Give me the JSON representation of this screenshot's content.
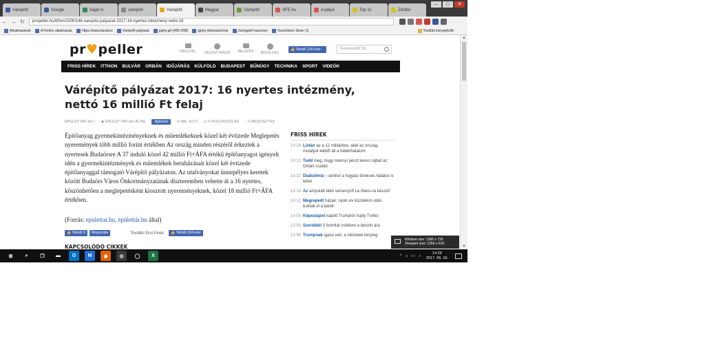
{
  "tabs": [
    {
      "label": "Várépítő",
      "color": "#3b5998"
    },
    {
      "label": "Google",
      "color": "#3b5998"
    },
    {
      "label": "Saját m",
      "color": "#2e8b57"
    },
    {
      "label": "várépítő",
      "color": "#888888"
    },
    {
      "label": "Várépítő",
      "color": "#f2a313",
      "active": true
    },
    {
      "label": "Magyar",
      "color": "#444444"
    },
    {
      "label": "Várépítő",
      "color": "#6a9a3a"
    },
    {
      "label": "SFE.hu",
      "color": "#d9534f"
    },
    {
      "label": "A pályá",
      "color": "#d9534f"
    },
    {
      "label": "Top 11",
      "color": "#d4c21a"
    },
    {
      "label": "Zöldbo",
      "color": "#d4c21a"
    }
  ],
  "window_controls": {
    "minimize": "–",
    "maximize": "□",
    "close": "✕"
  },
  "address": {
    "url": "propeller.hu/itthon/3290146-varepito-palyazat-2017-16-nyertes-intezmeny-netto-16"
  },
  "bookmarks": [
    "Alkalmazások",
    "A Firefox alkalmazás",
    "https://www.faceboo",
    "Várépítő pályázat",
    "giphy.gif (400×298)",
    "giphy-downsized-lar",
    "Zsíregető hasznom",
    "Touchdown Store | E"
  ],
  "bookmarks_other": "További könyvjelzők",
  "site": {
    "logo_left": "pr",
    "logo_heart": "♥",
    "logo_right": "peller",
    "header_icons": [
      "HÍRLEVÉL",
      "REGISZTRÁCIÓ",
      "BELÉPÉS",
      "BEKÜLDÉS"
    ],
    "like_label": "👍 Tetszik 104 ezer",
    "search_placeholder": "Keresendő hír..."
  },
  "nav": [
    "FRISS HÍREK",
    "ITTHON",
    "BULVÁR",
    "ORBÁN",
    "IDŐJÁRÁS",
    "KÜLFÖLD",
    "BUDAPEST",
    "BŰNÜGY",
    "TECHNIKA",
    "SPORT",
    "VIDEÓK"
  ],
  "article": {
    "title": "Várépítő pályázat 2017: 16 nyertes intézmény, nettó 16 millió Ft felaj",
    "meta_source": "EPULETTAR.HU /",
    "meta_author": "♟ ÉPÜLETTÁR.HU ÁLTAL",
    "meta_fb": "Ajánlom",
    "meta_time": "◷ MA, 10:27",
    "meta_comments": "▭ 0 HOZZÁSZÓLÁS",
    "meta_shares": "◌ 0 MEGOSZTÁS",
    "body": "Építőanyag gyermekintézményeknek és műemlékeknek közel két évtizede Meglepetés nyeremények több millió forint értékben Az ország minden részéről érkeztek a nyertesek Budaörsre A 37 induló közel 42 millió Ft+ÁFA értékű építőanyagot igényelt idén a gyermekintézmények és műemlékek beruházásait közel két évtizede építőanyaggal támogató Várépítő pályázaton. Az utalványokat ünnepélyes keretek között Budaörs Város Önkormányzatának díszteremben vehette át a 16 nyertes, köszönhetően a meglepetésként kiosztott nyereményeknek, közel 18 millió Ft+ÁFA értékben.",
    "source_prefix": "(Forrás: ",
    "source_links": "epulettar.hu, épülettár.hu",
    "source_suffix": " által)",
    "share_like": "👍 Tetszik 0",
    "share_button": "Megosztás",
    "more_news": "További friss hírek:",
    "more_like": "👍 Tetszik 104 ezer",
    "related_heading": "KAPCSOLÓDÓ CIKKEK"
  },
  "sidebar": {
    "heading": "FRISS HÍREK",
    "items": [
      {
        "time": "14:29",
        "bold": "Listán",
        "text": " az a 12 milliárdos, akié az ország, mutatjuk kikből áll a háttérhatalom"
      },
      {
        "time": "14:22",
        "bold": "Tudd",
        "text": " meg, hogy mennyi pénzt keres rajtad az Orbán család"
      },
      {
        "time": "14:22",
        "bold": "Diabulimia",
        "text": " – amikor a fogyási törekvés halálos is lehet"
      },
      {
        "time": "14:18",
        "bold": "Az",
        "text": " amputált lábú versenyző Le Mans-ra készül!"
      },
      {
        "time": "14:12",
        "bold": "Megrepedt",
        "text": " házak: nyolc év küzdelem után buktak el a lakók"
      },
      {
        "time": "14:05",
        "bold": "Képeslapot",
        "text": " kapott Trumptól Vujity Tvrtko"
      },
      {
        "time": "13:58",
        "bold": "Szerdától",
        "text": " 3 forinttal csökken a benzin ára"
      },
      {
        "time": "13:56",
        "bold": "Trumpnak",
        "text": " igaza van: a németek tényleg"
      }
    ]
  },
  "size_popup": {
    "window": "Window size:   1366 x 726",
    "viewport": "Viewport size:   1356 x 616"
  },
  "taskbar": {
    "apps": [
      "⊞",
      "⌕",
      "❐",
      "▬",
      "O",
      "M",
      "◉",
      "◎",
      "◯",
      "X"
    ],
    "tray_icons": [
      "^",
      "⌂",
      "▭",
      "♪"
    ],
    "time": "14:29",
    "date": "2017. 06. 19."
  }
}
